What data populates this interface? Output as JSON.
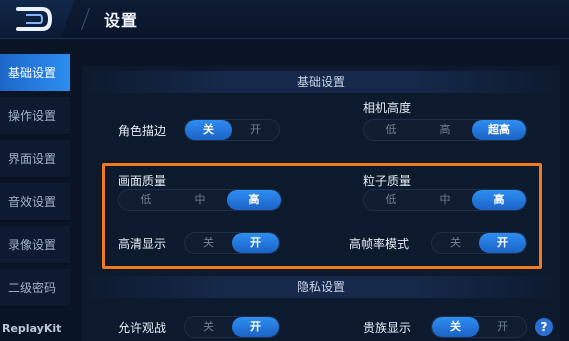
{
  "header": {
    "title": "设置"
  },
  "sidebar": {
    "items": [
      {
        "label": "基础设置",
        "active": true
      },
      {
        "label": "操作设置",
        "active": false
      },
      {
        "label": "界面设置",
        "active": false
      },
      {
        "label": "音效设置",
        "active": false
      },
      {
        "label": "录像设置",
        "active": false
      },
      {
        "label": "二级密码",
        "active": false
      }
    ],
    "watermark": "ReplayKit"
  },
  "basic": {
    "heading": "基础设置",
    "outline": {
      "label": "角色描边",
      "options": [
        "关",
        "开"
      ],
      "selected": "关"
    },
    "camera": {
      "label": "相机高度",
      "options": [
        "低",
        "高",
        "超高"
      ],
      "selected": "超高"
    },
    "quality": {
      "label": "画面质量",
      "options": [
        "低",
        "中",
        "高"
      ],
      "selected": "高"
    },
    "particle": {
      "label": "粒子质量",
      "options": [
        "低",
        "中",
        "高"
      ],
      "selected": "高"
    },
    "hd": {
      "label": "高清显示",
      "options": [
        "关",
        "开"
      ],
      "selected": "开"
    },
    "hfr": {
      "label": "高帧率模式",
      "options": [
        "关",
        "开"
      ],
      "selected": "开"
    }
  },
  "privacy": {
    "heading": "隐私设置",
    "spectate": {
      "label": "允许观战",
      "options": [
        "关",
        "开"
      ],
      "selected": "开"
    },
    "noble": {
      "label": "贵族显示",
      "options": [
        "关",
        "开"
      ],
      "selected": "关"
    },
    "help": "?"
  },
  "colors": {
    "accent": "#2e8ef2",
    "highlight": "#f07a1c",
    "background": "#0a1426"
  }
}
